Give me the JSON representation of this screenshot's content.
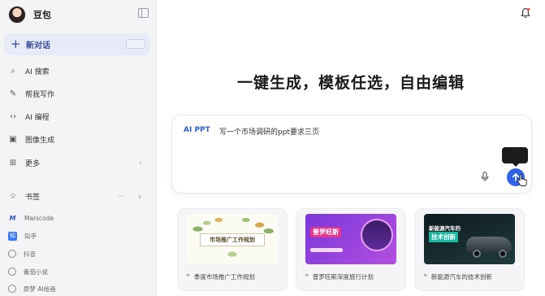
{
  "sidebar": {
    "brand_name": "豆包",
    "new_chat_label": "新对话",
    "nav": [
      {
        "label": "AI 搜索",
        "icon": "search-icon"
      },
      {
        "label": "帮我写作",
        "icon": "pen-icon"
      },
      {
        "label": "AI 编程",
        "icon": "code-icon"
      },
      {
        "label": "图像生成",
        "icon": "image-icon"
      },
      {
        "label": "更多",
        "icon": "grid-icon"
      }
    ],
    "bookmarks_title": "书签",
    "bookmarks": [
      {
        "label": "Marscode",
        "icon": "marscode-icon"
      },
      {
        "label": "知乎",
        "icon": "zhihu-icon"
      },
      {
        "label": "抖音",
        "icon": "globe-icon"
      },
      {
        "label": "番茄小说",
        "icon": "globe-icon"
      },
      {
        "label": "即梦 AI绘画",
        "icon": "globe-icon"
      }
    ]
  },
  "main": {
    "headline": "一键生成，模板任选，自由编辑",
    "input": {
      "tag": "AI PPT",
      "text": "写一个市场调研的ppt要求三页"
    },
    "templates": [
      {
        "thumb_title": "市场推广工作规划",
        "caption": "季度市场推广工作规划"
      },
      {
        "thumb_title": "普罗旺斯",
        "caption": "普罗旺斯深度旅行计划"
      },
      {
        "thumb_title": "技术创新",
        "thumb_tag": "新能源汽车的",
        "caption": "新能源汽车的技术创新"
      }
    ]
  },
  "colors": {
    "accent": "#2f62e8",
    "sidebar_bg": "#f4f4f6",
    "new_chat_bg": "#e7ebf7"
  }
}
